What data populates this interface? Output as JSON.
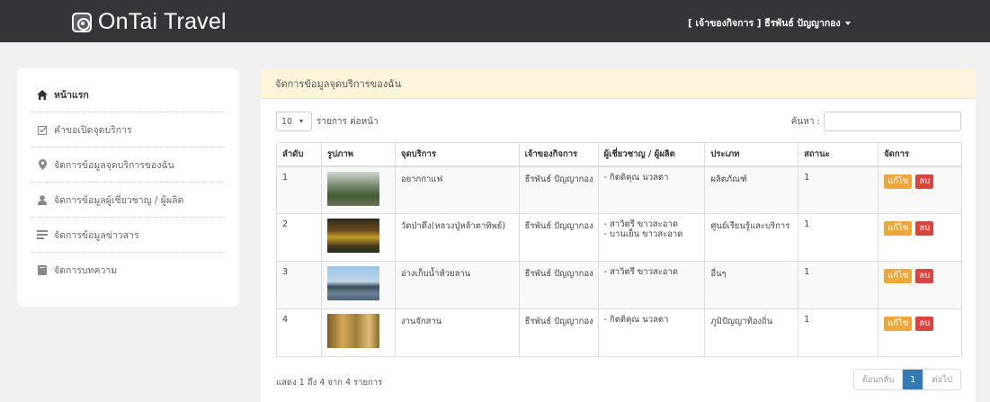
{
  "app": {
    "brand": "OnTai Travel",
    "user_menu": "[ เจ้าของกิจการ ] ธีรพันธ์ ปัญญากอง"
  },
  "sidebar": {
    "items": [
      {
        "label": "หน้าแรก",
        "icon": "home-icon"
      },
      {
        "label": "คำขอเปิดจุดบริการ",
        "icon": "check-square-icon"
      },
      {
        "label": "จัดการข้อมูลจุดบริการของฉัน",
        "icon": "map-marker-icon"
      },
      {
        "label": "จัดการข้อมูลผู้เชี่ยวชาญ / ผู้ผลิต",
        "icon": "user-icon"
      },
      {
        "label": "จัดการข้อมูลข่าวสาร",
        "icon": "news-icon"
      },
      {
        "label": "จัดการบทความ",
        "icon": "book-icon"
      }
    ]
  },
  "panel": {
    "title": "จัดการข้อมูลจุดบริการของฉัน",
    "page_size": "10",
    "page_size_label": "รายการ ต่อหน้า",
    "search_label": "ค้นหา :",
    "search_value": ""
  },
  "table": {
    "headers": [
      "ลำดับ",
      "รูปภาพ",
      "จุดบริการ",
      "เจ้าของกิจการ",
      "ผู้เชี่ยวชาญ / ผู้ผลิต",
      "ประเภท",
      "สถานะ",
      "จัดการ"
    ],
    "rows": [
      {
        "no": "1",
        "place": "อยากกาแฟ",
        "owner": "ธีรพันธ์ ปัญญากอง",
        "experts": [
          "- กิตติคุณ นวลตา"
        ],
        "type": "ผลิตภัณฑ์",
        "status": "1"
      },
      {
        "no": "2",
        "place": "วัดป่าดึง(หลวงปู่หล้าตาทิพย์)",
        "owner": "ธีรพันธ์ ปัญญากอง",
        "experts": [
          "- สาวิตรี ขาวสะอาด",
          "- บานเย็น ขาวสะอาด"
        ],
        "type": "ศูนย์เรียนรู้และบริการ",
        "status": "1"
      },
      {
        "no": "3",
        "place": "อ่างเก็บน้ำห้วยลาน",
        "owner": "ธีรพันธ์ ปัญญากอง",
        "experts": [
          "- สาวิตรี ขาวสะอาด"
        ],
        "type": "อื่นๆ",
        "status": "1"
      },
      {
        "no": "4",
        "place": "งานจักสาน",
        "owner": "ธีรพันธ์ ปัญญากอง",
        "experts": [
          "- กิตติคุณ นวลตา"
        ],
        "type": "ภูมิปัญญาท้องถิ่น",
        "status": "1"
      }
    ],
    "edit_label": "แก้ไข",
    "delete_label": "ลบ"
  },
  "footer": {
    "info": "แสดง 1 ถึง 4 จาก 4 รายการ",
    "prev": "ย้อนกลับ",
    "current_page": "1",
    "next": "ต่อไป"
  },
  "colors": {
    "topbar": "#32363b",
    "panel_header": "#fcf5dc",
    "edit": "#f0a73a",
    "delete": "#d9443f",
    "page_active": "#337ab7"
  }
}
